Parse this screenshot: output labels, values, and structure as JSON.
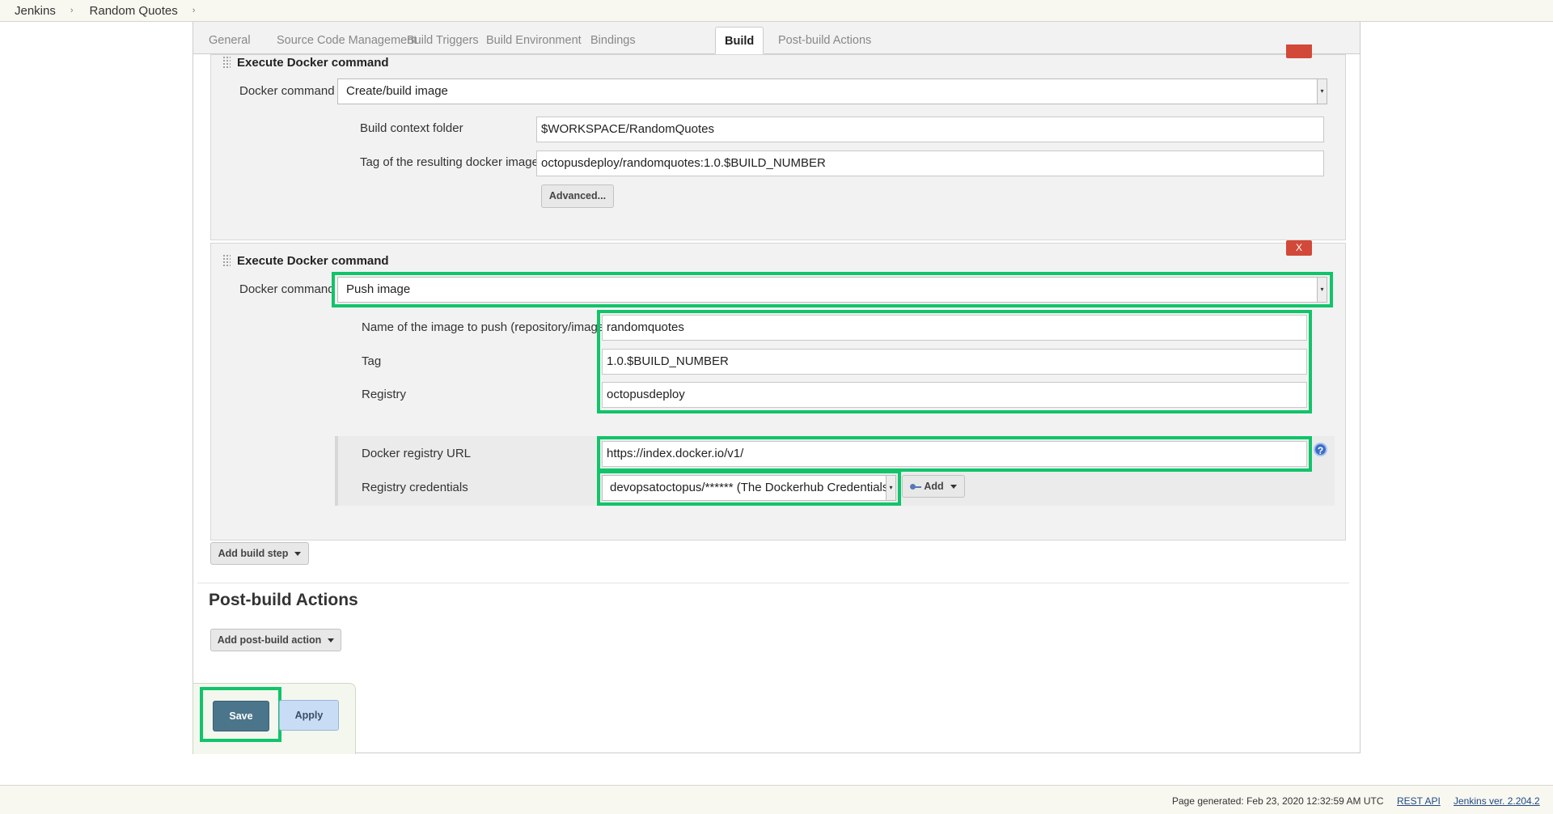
{
  "breadcrumb": {
    "items": [
      "Jenkins",
      "Random Quotes"
    ]
  },
  "tabs": [
    "General",
    "Source Code Management",
    "Build Triggers",
    "Build Environment",
    "Bindings",
    "Build",
    "Post-build Actions"
  ],
  "active_tab": "Build",
  "step1": {
    "title": "Execute Docker command",
    "docker_command_label": "Docker command",
    "docker_command_value": "Create/build image",
    "context_label": "Build context folder",
    "context_value": "$WORKSPACE/RandomQuotes",
    "tag_label": "Tag of the resulting docker image",
    "tag_value": "octopusdeploy/randomquotes:1.0.$BUILD_NUMBER",
    "advanced_label": "Advanced..."
  },
  "step2": {
    "title": "Execute Docker command",
    "delete_label": "X",
    "docker_command_label": "Docker command",
    "docker_command_value": "Push image",
    "image_name_label": "Name of the image to push (repository/image)",
    "image_name_value": "randomquotes",
    "tag_label": "Tag",
    "tag_value": "1.0.$BUILD_NUMBER",
    "registry_label": "Registry",
    "registry_value": "octopusdeploy",
    "registry_url_label": "Docker registry URL",
    "registry_url_value": "https://index.docker.io/v1/",
    "credentials_label": "Registry credentials",
    "credentials_value": "devopsatoctopus/****** (The Dockerhub Credentials)",
    "add_label": "Add",
    "help_label": "?"
  },
  "add_build_step_label": "Add build step",
  "post_build": {
    "heading": "Post-build Actions",
    "add_label": "Add post-build action"
  },
  "actions": {
    "save_label": "Save",
    "apply_label": "Apply"
  },
  "footer": {
    "generated": "Page generated: Feb 23, 2020 12:32:59 AM UTC",
    "rest_api": "REST API",
    "version": "Jenkins ver. 2.204.2"
  },
  "colors": {
    "highlight": "#10c46a",
    "delete_button": "#d24939",
    "save_button": "#4b758b",
    "apply_button": "#c9dcf5"
  }
}
